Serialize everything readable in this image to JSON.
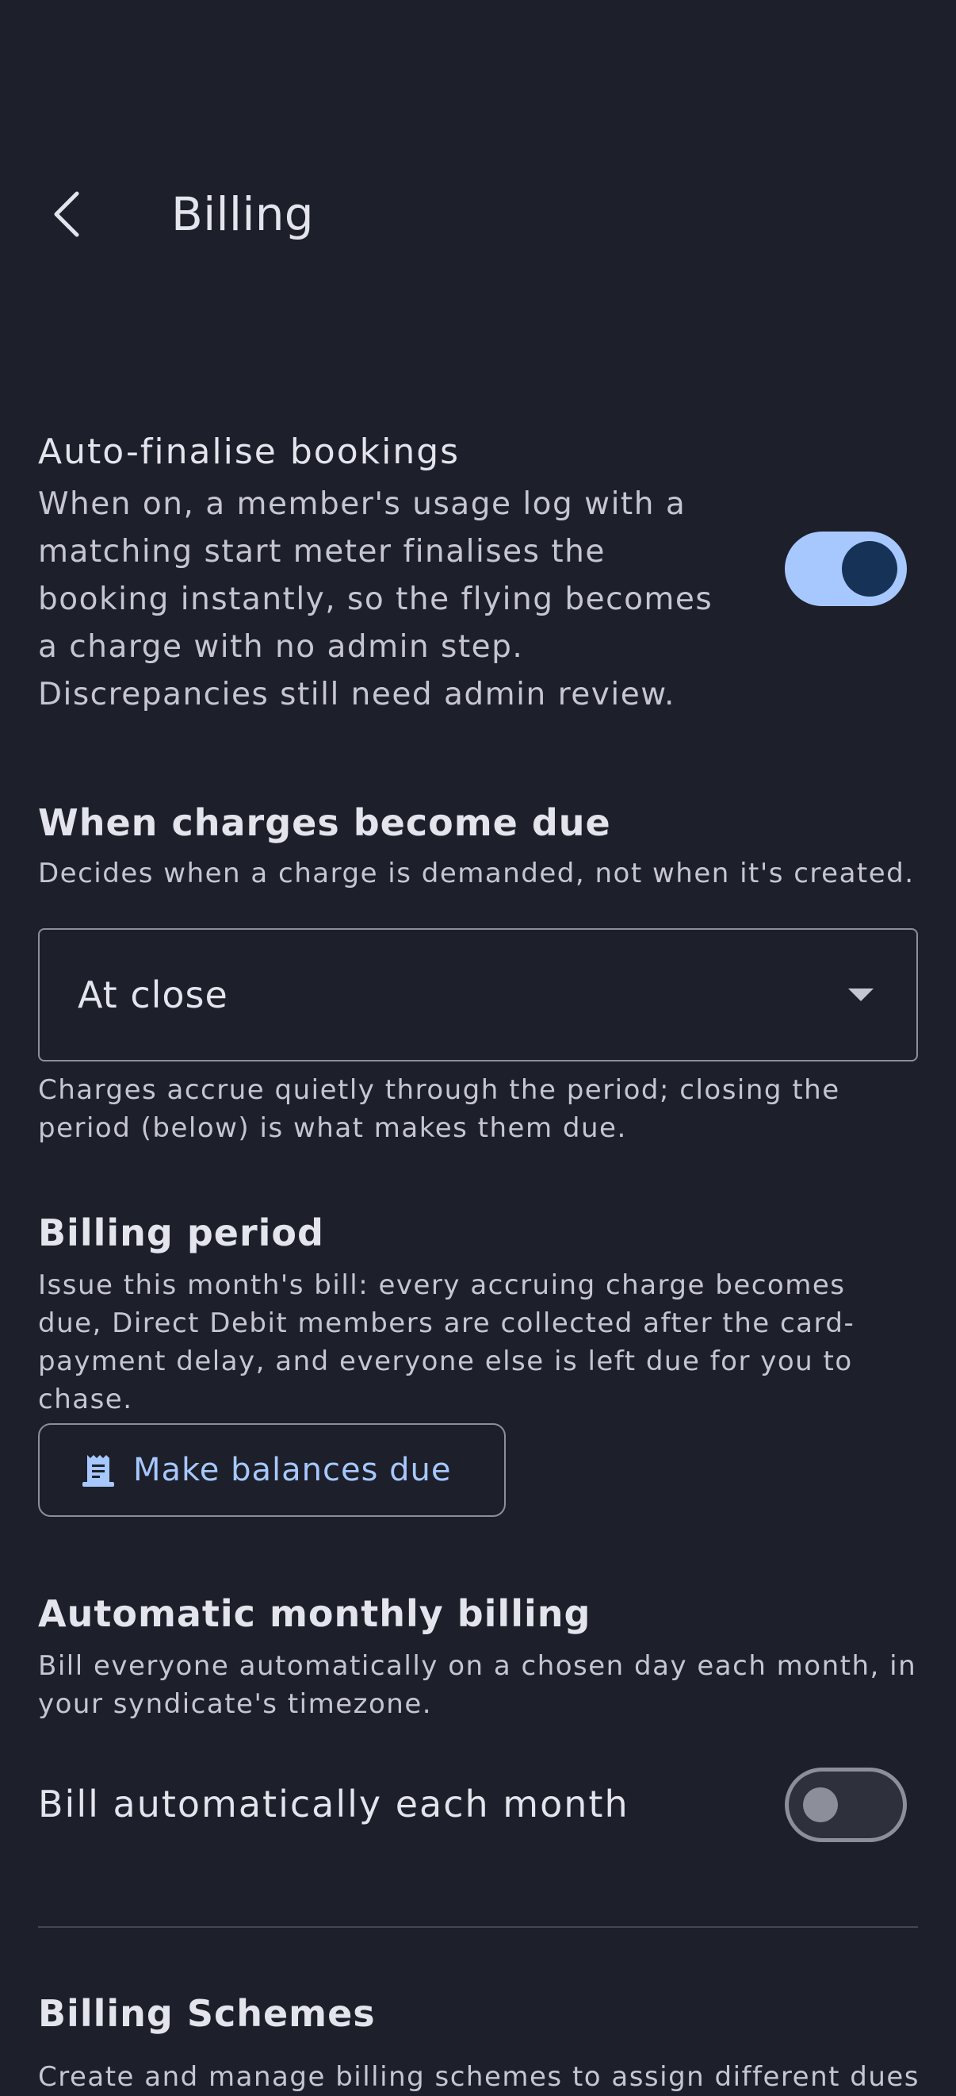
{
  "header": {
    "title": "Billing"
  },
  "auto_finalise": {
    "title": "Auto-finalise bookings",
    "description": "When on, a member's usage log with a matching start meter finalises the booking instantly, so the flying becomes a charge with no admin step. Discrepancies still need admin review.",
    "enabled": true
  },
  "charges_due": {
    "title": "When charges become due",
    "description": "Decides when a charge is demanded, not when it's created.",
    "selected_value": "At close",
    "helper": "Charges accrue quietly through the period; closing the period (below) is what makes them due."
  },
  "billing_period": {
    "title": "Billing period",
    "description": "Issue this month's bill: every accruing charge becomes due, Direct Debit members are collected after the card-payment delay, and everyone else is left due for you to chase.",
    "button_label": "Make balances due",
    "button_icon": "receipt-icon"
  },
  "monthly_billing": {
    "title": "Automatic monthly billing",
    "description": "Bill everyone automatically on a chosen day each month, in your syndicate's timezone.",
    "toggle_label": "Bill automatically each month",
    "enabled": false
  },
  "billing_schemes": {
    "title": "Billing Schemes",
    "description": "Create and manage billing schemes to assign different dues"
  },
  "colors": {
    "background": "#1d1f2a",
    "accent": "#a7c8ff",
    "switch_knob_on": "#163357",
    "outline": "#8c8f99"
  }
}
